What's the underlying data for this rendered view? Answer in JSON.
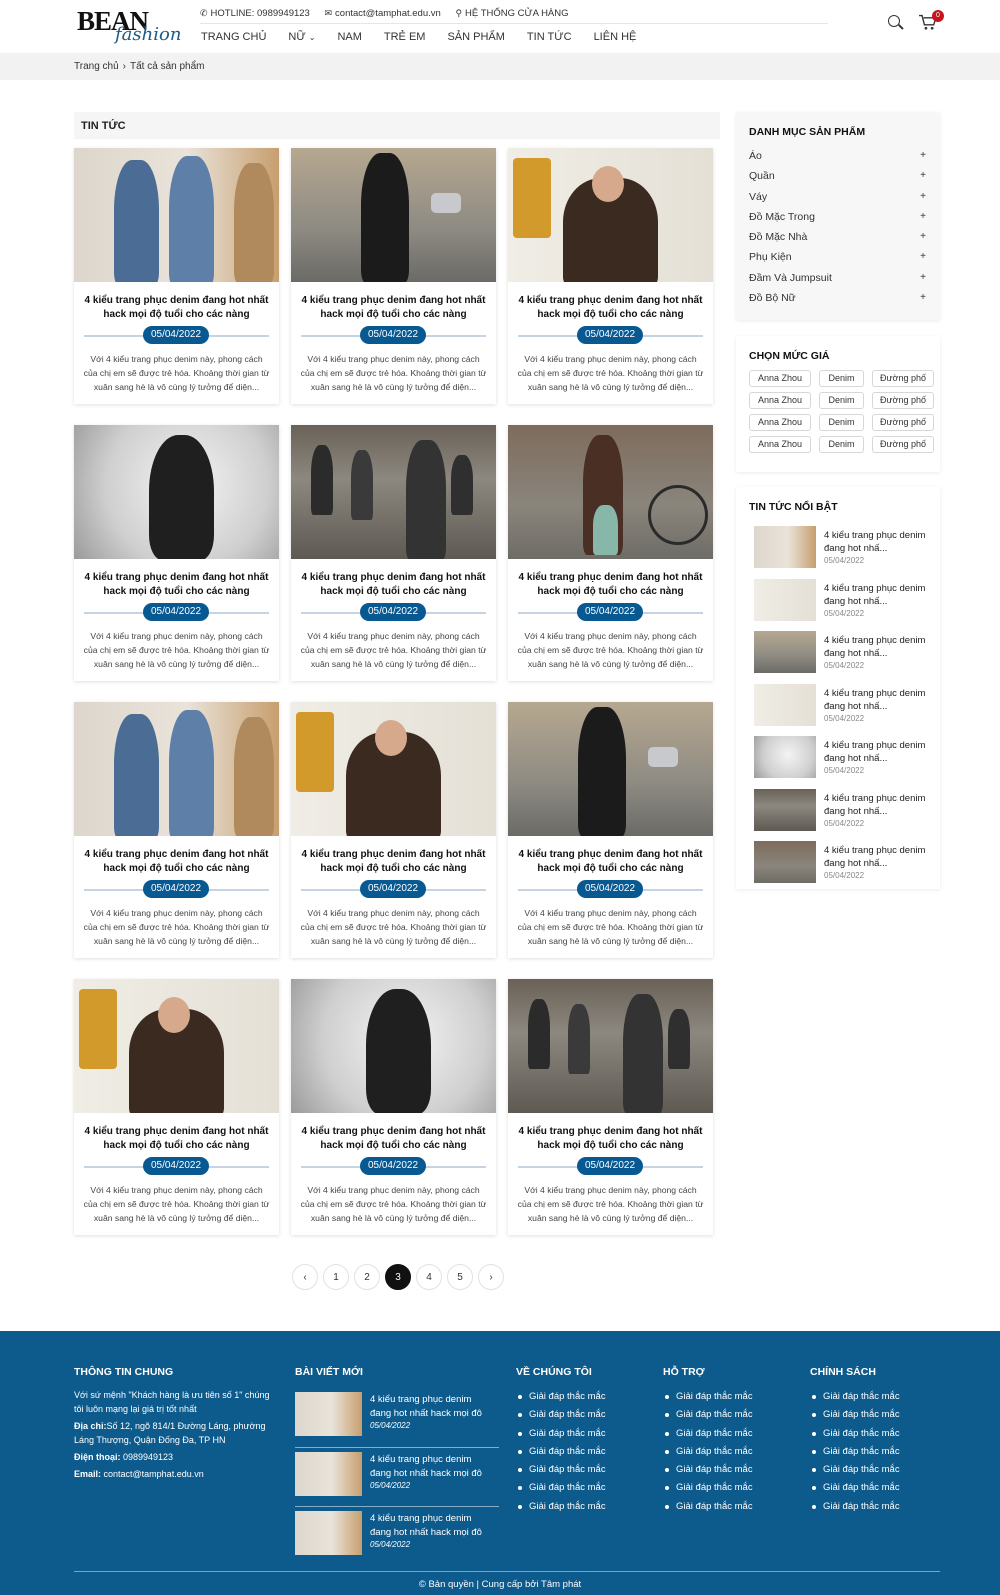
{
  "header": {
    "logo_main": "BEAN",
    "logo_script": "fashion",
    "hotline": "HOTLINE: 0989949123",
    "email": "contact@tamphat.edu.vn",
    "stores": "HỆ THỐNG CỬA HÀNG",
    "nav": [
      "TRANG CHỦ",
      "NỮ",
      "NAM",
      "TRẺ EM",
      "SẢN PHẨM",
      "TIN TỨC",
      "LIÊN HỆ"
    ],
    "cart_count": "0"
  },
  "breadcrumb": {
    "home": "Trang chủ",
    "current": "Tất cả sản phẩm"
  },
  "main": {
    "title": "TIN TỨC",
    "cards": [
      {
        "title": "4 kiểu trang phục denim đang hot nhất hack mọi độ tuổi cho các nàng",
        "date": "05/04/2022",
        "excerpt": "Với 4 kiểu trang phục denim này, phong cách của chị em sẽ được trẻ hóa. Khoảng thời gian từ xuân sang hè là vô cùng lý tưởng để diện..."
      },
      {
        "title": "4 kiểu trang phục denim đang hot nhất hack mọi độ tuổi cho các nàng",
        "date": "05/04/2022",
        "excerpt": "Với 4 kiểu trang phục denim này, phong cách của chị em sẽ được trẻ hóa. Khoảng thời gian từ xuân sang hè là vô cùng lý tưởng để diện..."
      },
      {
        "title": "4 kiểu trang phục denim đang hot nhất hack mọi độ tuổi cho các nàng",
        "date": "05/04/2022",
        "excerpt": "Với 4 kiểu trang phục denim này, phong cách của chị em sẽ được trẻ hóa. Khoảng thời gian từ xuân sang hè là vô cùng lý tưởng để diện..."
      },
      {
        "title": "4 kiểu trang phục denim đang hot nhất hack mọi độ tuổi cho các nàng",
        "date": "05/04/2022",
        "excerpt": "Với 4 kiểu trang phục denim này, phong cách của chị em sẽ được trẻ hóa. Khoảng thời gian từ xuân sang hè là vô cùng lý tưởng để diện..."
      },
      {
        "title": "4 kiểu trang phục denim đang hot nhất hack mọi độ tuổi cho các nàng",
        "date": "05/04/2022",
        "excerpt": "Với 4 kiểu trang phục denim này, phong cách của chị em sẽ được trẻ hóa. Khoảng thời gian từ xuân sang hè là vô cùng lý tưởng để diện..."
      },
      {
        "title": "4 kiểu trang phục denim đang hot nhất hack mọi độ tuổi cho các nàng",
        "date": "05/04/2022",
        "excerpt": "Với 4 kiểu trang phục denim này, phong cách của chị em sẽ được trẻ hóa. Khoảng thời gian từ xuân sang hè là vô cùng lý tưởng để diện..."
      },
      {
        "title": "4 kiểu trang phục denim đang hot nhất hack mọi độ tuổi cho các nàng",
        "date": "05/04/2022",
        "excerpt": "Với 4 kiểu trang phục denim này, phong cách của chị em sẽ được trẻ hóa. Khoảng thời gian từ xuân sang hè là vô cùng lý tưởng để diện..."
      },
      {
        "title": "4 kiểu trang phục denim đang hot nhất hack mọi độ tuổi cho các nàng",
        "date": "05/04/2022",
        "excerpt": "Với 4 kiểu trang phục denim này, phong cách của chị em sẽ được trẻ hóa. Khoảng thời gian từ xuân sang hè là vô cùng lý tưởng để diện..."
      },
      {
        "title": "4 kiểu trang phục denim đang hot nhất hack mọi độ tuổi cho các nàng",
        "date": "05/04/2022",
        "excerpt": "Với 4 kiểu trang phục denim này, phong cách của chị em sẽ được trẻ hóa. Khoảng thời gian từ xuân sang hè là vô cùng lý tưởng để diện..."
      },
      {
        "title": "4 kiểu trang phục denim đang hot nhất hack mọi độ tuổi cho các nàng",
        "date": "05/04/2022",
        "excerpt": "Với 4 kiểu trang phục denim này, phong cách của chị em sẽ được trẻ hóa. Khoảng thời gian từ xuân sang hè là vô cùng lý tưởng để diện..."
      },
      {
        "title": "4 kiểu trang phục denim đang hot nhất hack mọi độ tuổi cho các nàng",
        "date": "05/04/2022",
        "excerpt": "Với 4 kiểu trang phục denim này, phong cách của chị em sẽ được trẻ hóa. Khoảng thời gian từ xuân sang hè là vô cùng lý tưởng để diện..."
      },
      {
        "title": "4 kiểu trang phục denim đang hot nhất hack mọi độ tuổi cho các nàng",
        "date": "05/04/2022",
        "excerpt": "Với 4 kiểu trang phục denim này, phong cách của chị em sẽ được trẻ hóa. Khoảng thời gian từ xuân sang hè là vô cùng lý tưởng để diện..."
      }
    ]
  },
  "pagination": {
    "pages": [
      "1",
      "2",
      "3",
      "4",
      "5"
    ],
    "current": "3"
  },
  "sidebar": {
    "categories_title": "DANH MỤC SẢN PHẨM",
    "categories": [
      "Áo",
      "Quần",
      "Váy",
      "Đồ Mặc Trong",
      "Đồ Mặc Nhà",
      "Phụ Kiện",
      "Đầm Và Jumpsuit",
      "Đồ Bộ Nữ"
    ],
    "price_title": "CHỌN MỨC GIÁ",
    "tags": [
      "Anna Zhou",
      "Denim",
      "Đường phố",
      "Anna Zhou",
      "Denim",
      "Đường phố",
      "Anna Zhou",
      "Denim",
      "Đường phố",
      "Anna Zhou",
      "Denim",
      "Đường phố"
    ],
    "featured_title": "TIN TỨC NỔI BẬT",
    "featured": [
      {
        "title": "4 kiểu trang phục denim đang hot nhấ...",
        "date": "05/04/2022"
      },
      {
        "title": "4 kiểu trang phục denim đang hot nhấ...",
        "date": "05/04/2022"
      },
      {
        "title": "4 kiểu trang phục denim đang hot nhấ...",
        "date": "05/04/2022"
      },
      {
        "title": "4 kiểu trang phục denim đang hot nhấ...",
        "date": "05/04/2022"
      },
      {
        "title": "4 kiểu trang phục denim đang hot nhấ...",
        "date": "05/04/2022"
      },
      {
        "title": "4 kiểu trang phục denim đang hot nhấ...",
        "date": "05/04/2022"
      },
      {
        "title": "4 kiểu trang phục denim đang hot nhấ...",
        "date": "05/04/2022"
      }
    ]
  },
  "footer": {
    "info_title": "THÔNG TIN CHUNG",
    "mission": "Với sứ mệnh \"Khách hàng là ưu tiên số 1\" chúng tôi luôn mạng lại giá trị tốt nhất",
    "address_label": "Địa chỉ:",
    "address": "Số 12, ngõ 814/1 Đường Láng, phường Láng Thượng, Quận Đống Đa, TP HN",
    "phone_label": "Điện thoại:",
    "phone": " 0989949123",
    "email_label": "Email:",
    "email": " contact@tamphat.edu.vn",
    "posts_title": "BÀI VIẾT MỚI",
    "posts": [
      {
        "title": "4 kiểu trang phục denim đang hot nhất hack mọi đô",
        "date": "05/04/2022"
      },
      {
        "title": "4 kiểu trang phục denim đang hot nhất hack mọi đô",
        "date": "05/04/2022"
      },
      {
        "title": "4 kiểu trang phục denim đang hot nhất hack mọi đô",
        "date": "05/04/2022"
      }
    ],
    "about_title": "VỀ CHÚNG TÔI",
    "support_title": "HỖ TRỢ",
    "policy_title": "CHÍNH SÁCH",
    "link_label": "Giải đáp thắc mắc",
    "copyright": "© Bản quyền | Cung cấp bởi Tâm phát"
  },
  "colors": {
    "primary": "#085891",
    "footer_bg": "#0d5a8c",
    "badge": "#c4161c"
  }
}
